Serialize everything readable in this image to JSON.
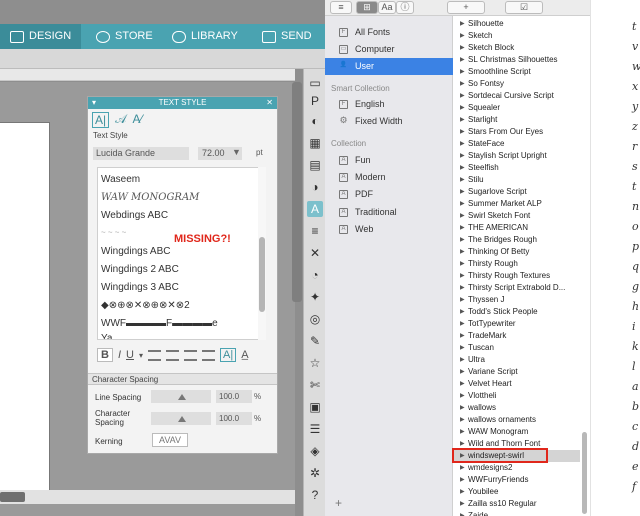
{
  "studio": {
    "tabs": [
      {
        "label": "DESIGN",
        "icon": "grid-icon"
      },
      {
        "label": "STORE",
        "icon": "store-icon"
      },
      {
        "label": "LIBRARY",
        "icon": "cloud-icon"
      },
      {
        "label": "SEND",
        "icon": "cutter-icon"
      }
    ],
    "text_style_panel": {
      "title": "TEXT STYLE",
      "section_text_style": "Text Style",
      "font_name": "Lucida Grande",
      "font_size": "72.00",
      "size_unit": "pt",
      "font_list": [
        "Waseem",
        "WAW MONOGRAM",
        "Webdings ABC",
        "",
        "Wingdings ABC",
        "Wingdings 2 ABC",
        "Wingdings 3 ABC",
        "◆⊗⊕⊗✕⊗⊕⊗✕⊗2",
        "WWF▬▬▬▬F▬▬▬▬e",
        "Ya"
      ],
      "annotation": "MISSING?!",
      "section_character_spacing": "Character Spacing",
      "line_spacing_label": "Line Spacing",
      "line_spacing_value": "100.0",
      "character_spacing_label": "Character Spacing",
      "character_spacing_value": "100.0",
      "percent": "%",
      "kerning_label": "Kerning",
      "kerning_value": "AVAV"
    }
  },
  "fontbook": {
    "toolbar": {
      "buttons": [
        "≡",
        "⊞",
        "Aa",
        "ⓘ",
        "+",
        "☑"
      ]
    },
    "sidebar": {
      "library": [
        {
          "label": "All Fonts",
          "icon": "F"
        },
        {
          "label": "Computer",
          "icon": "▭"
        },
        {
          "label": "User",
          "icon": "👤"
        }
      ],
      "smart_header": "Smart Collection",
      "smart": [
        {
          "label": "English",
          "icon": "F"
        },
        {
          "label": "Fixed Width",
          "icon": "⚙"
        }
      ],
      "collection_header": "Collection",
      "collections": [
        {
          "label": "Fun",
          "icon": "A"
        },
        {
          "label": "Modern",
          "icon": "A"
        },
        {
          "label": "PDF",
          "icon": "A"
        },
        {
          "label": "Traditional",
          "icon": "A"
        },
        {
          "label": "Web",
          "icon": "A"
        }
      ],
      "add": "+"
    },
    "font_list": [
      "Silhouette",
      "Sketch",
      "Sketch Block",
      "SL Christmas Silhouettes",
      "Smoothline Script",
      "So Fontsy",
      "Sortdecai Cursive Script",
      "Squealer",
      "Starlight",
      "Stars From Our Eyes",
      "StateFace",
      "Staylish Script Upright",
      "Steelfish",
      "Stilu",
      "Sugarlove Script",
      "Summer Market ALP",
      "Swirl Sketch Font",
      "THE AMERICAN",
      "The Bridges Rough",
      "Thinking Of Betty",
      "Thirsty Rough",
      "Thirsty Rough Textures",
      "Thirsty Script Extrabold D...",
      "Thyssen J",
      "Todd's Stick People",
      "TotTypewriter",
      "TradeMark",
      "Tuscan",
      "Ultra",
      "Variane Script",
      "Velvet Heart",
      "Vlottheli",
      "wallows",
      "wallows ornaments",
      "WAW Monogram",
      "Wild and Thorn Font",
      "windswept-swirl",
      "wmdesigns2",
      "WWFurryFriends",
      "Youbilee",
      "Zailla ss10 Regular",
      "Zaide"
    ],
    "selected_font": "windswept-swirl",
    "preview_glyphs": [
      "t",
      "v",
      "w",
      "x",
      "y",
      "z",
      "r",
      "s",
      "t",
      "n",
      "o",
      "p",
      "q",
      "g",
      "h",
      "i",
      "k",
      "l",
      "a",
      "b",
      "c",
      "d",
      "e",
      "f"
    ]
  }
}
